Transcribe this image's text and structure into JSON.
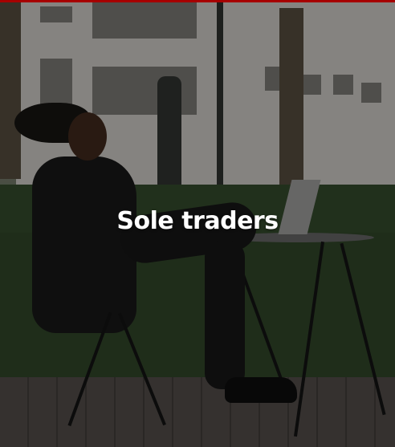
{
  "card": {
    "title": "Sole traders"
  },
  "colors": {
    "accent_bar": "#e60000",
    "title_text": "#ffffff"
  }
}
